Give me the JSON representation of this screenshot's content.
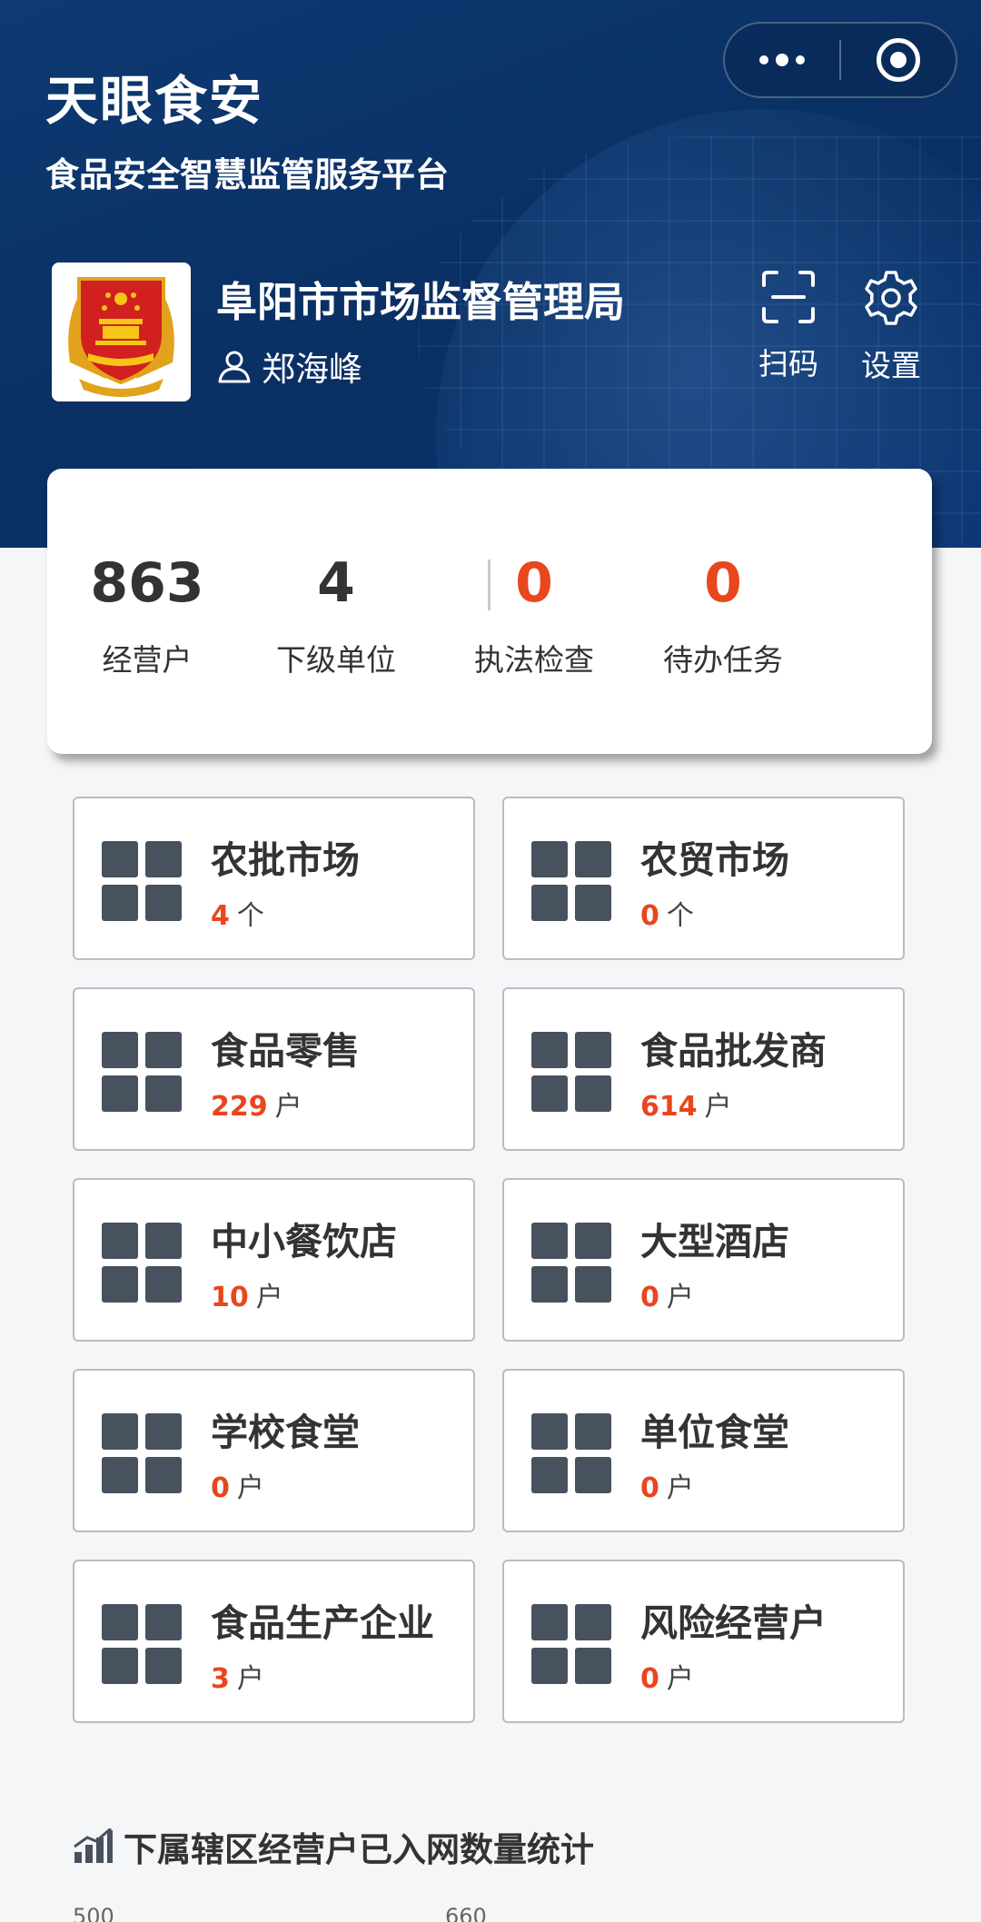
{
  "app": {
    "title": "天眼食安",
    "subtitle": "食品安全智慧监管服务平台"
  },
  "org": {
    "name": "阜阳市市场监督管理局",
    "user": "郑海峰"
  },
  "actions": {
    "scan_label": "扫码",
    "settings_label": "设置"
  },
  "stats": [
    {
      "value": "863",
      "label": "经营户"
    },
    {
      "value": "4",
      "label": "下级单位"
    },
    {
      "value": "0",
      "label": "执法检查"
    },
    {
      "value": "0",
      "label": "待办任务"
    }
  ],
  "categories": [
    {
      "name": "农批市场",
      "count": "4",
      "unit": "个"
    },
    {
      "name": "农贸市场",
      "count": "0",
      "unit": "个"
    },
    {
      "name": "食品零售",
      "count": "229",
      "unit": "户"
    },
    {
      "name": "食品批发商",
      "count": "614",
      "unit": "户"
    },
    {
      "name": "中小餐饮店",
      "count": "10",
      "unit": "户"
    },
    {
      "name": "大型酒店",
      "count": "0",
      "unit": "户"
    },
    {
      "name": "学校食堂",
      "count": "0",
      "unit": "户"
    },
    {
      "name": "单位食堂",
      "count": "0",
      "unit": "户"
    },
    {
      "name": "食品生产企业",
      "count": "3",
      "unit": "户"
    },
    {
      "name": "风险经营户",
      "count": "0",
      "unit": "户"
    }
  ],
  "chart_section": {
    "title": "下属辖区经营户已入网数量统计",
    "axis_top": "500",
    "value_peek": "660"
  },
  "colors": {
    "header_bg": "#0a2f63",
    "accent_red": "#e8461d",
    "tile_icon": "#48515e"
  }
}
